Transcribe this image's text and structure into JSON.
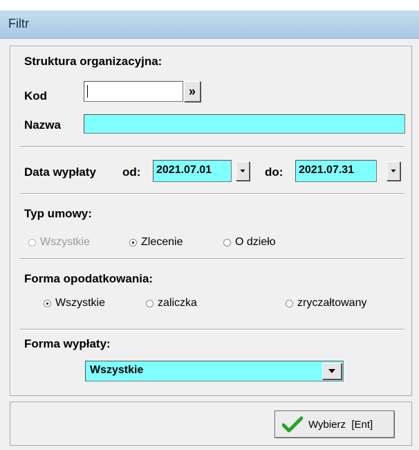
{
  "window": {
    "title": "Filtr"
  },
  "org_structure": {
    "heading": "Struktura organizacyjna:",
    "kod_label": "Kod",
    "kod_value": "",
    "lookup_button": "»",
    "nazwa_label": "Nazwa",
    "nazwa_value": ""
  },
  "payout_date": {
    "label": "Data wypłaty",
    "from_label": "od:",
    "from_value": "2021.07.01",
    "to_label": "do:",
    "to_value": "2021.07.31"
  },
  "contract_type": {
    "heading": "Typ umowy:",
    "options": [
      {
        "label": "Wszystkie",
        "checked": false,
        "disabled": true
      },
      {
        "label": "Zlecenie",
        "checked": true,
        "disabled": false
      },
      {
        "label": "O dzieło",
        "checked": false,
        "disabled": false
      }
    ]
  },
  "taxation": {
    "heading": "Forma opodatkowania:",
    "options": [
      {
        "label": "Wszystkie",
        "checked": true
      },
      {
        "label": "zaliczka",
        "checked": false
      },
      {
        "label": "zryczałtowany",
        "checked": false
      }
    ]
  },
  "payout_form": {
    "heading": "Forma wypłaty:",
    "selected": "Wszystkie"
  },
  "select_button": {
    "label": "Wybierz  [Ent]",
    "icon": "checkmark-icon"
  },
  "colors": {
    "field_highlight": "#80ffff",
    "titlebar": "#b4d0ea",
    "checkmark": "#2aa12a"
  }
}
